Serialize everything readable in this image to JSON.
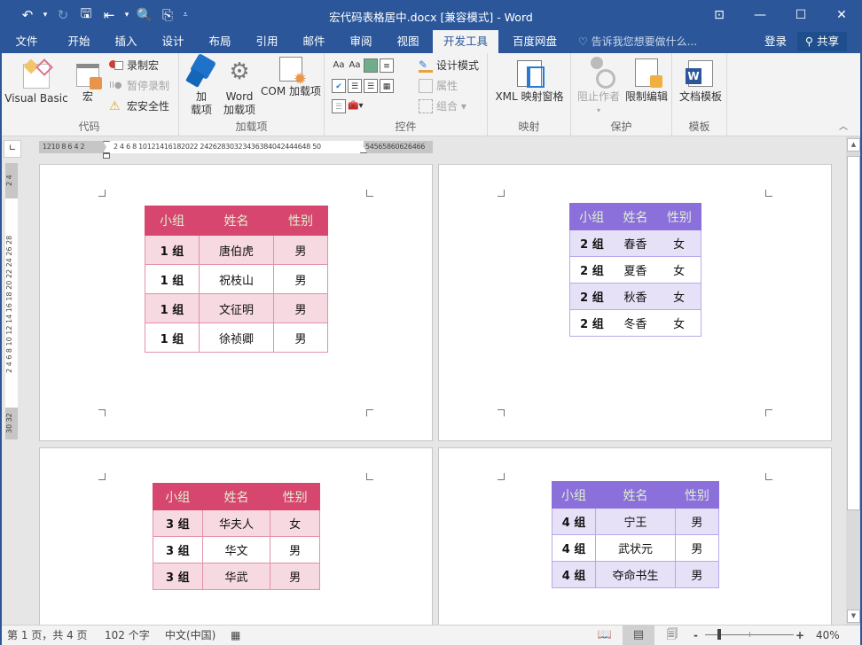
{
  "window": {
    "title": "宏代码表格居中.docx [兼容模式] - Word",
    "qat": [
      {
        "name": "undo-icon",
        "glyph": "↶"
      },
      {
        "name": "undo-dropdown-icon",
        "glyph": "▾"
      },
      {
        "name": "redo-icon",
        "glyph": "↻"
      },
      {
        "name": "save-icon",
        "glyph": "🖫"
      },
      {
        "name": "touch-mode-icon",
        "glyph": "⇤"
      },
      {
        "name": "touch-dropdown-icon",
        "glyph": "▾"
      },
      {
        "name": "print-preview-icon",
        "glyph": "🔍"
      },
      {
        "name": "new-comment-icon",
        "glyph": "⎘"
      },
      {
        "name": "customize-qat-icon",
        "glyph": "⩡"
      }
    ],
    "controls": {
      "ribbon_display": "⊡",
      "minimize": "—",
      "maximize": "☐",
      "close": "✕"
    }
  },
  "tabs": [
    {
      "label": "文件"
    },
    {
      "label": "开始"
    },
    {
      "label": "插入"
    },
    {
      "label": "设计"
    },
    {
      "label": "布局"
    },
    {
      "label": "引用"
    },
    {
      "label": "邮件"
    },
    {
      "label": "审阅"
    },
    {
      "label": "视图"
    },
    {
      "label": "开发工具",
      "active": true
    },
    {
      "label": "百度网盘"
    }
  ],
  "tellme": {
    "icon": "lightbulb-icon",
    "glyph": "♡",
    "placeholder": "告诉我您想要做什么..."
  },
  "account": {
    "login": "登录",
    "share": "共享",
    "share_glyph": "⚲"
  },
  "ribbon": {
    "groups": {
      "code": {
        "label": "代码",
        "visual_basic": "Visual Basic",
        "macros": "宏",
        "record_macro": "录制宏",
        "pause_recording": "暂停录制",
        "macro_security": "宏安全性"
      },
      "addins": {
        "label": "加载项",
        "addins_line1": "加",
        "addins_line2": "载项",
        "word_addins_line1": "Word",
        "word_addins_line2": "加载项",
        "com_addins": "COM 加载项"
      },
      "controls": {
        "label": "控件",
        "design_mode": "设计模式",
        "properties": "属性",
        "group": "组合 ▾"
      },
      "mapping": {
        "label": "映射",
        "xml_pane": "XML 映射窗格"
      },
      "protect": {
        "label": "保护",
        "block_authors": "阻止作者",
        "restrict_editing": "限制编辑"
      },
      "templates": {
        "label": "模板",
        "document_template": "文档模板"
      }
    }
  },
  "ruler": {
    "corner_glyph": "∟",
    "h_left": "1210 8  6  4  2",
    "h_mid": "2  4  6  8 10121416182022 24262830323436384042444648 50",
    "h_right": "54565860626466",
    "v_top": "2  4",
    "v_mid": "2  4  6  8  10  12  14  16  18  20  22  24  26  28",
    "v_bottom": "30  32"
  },
  "tables": [
    {
      "headers": [
        "小组",
        "姓名",
        "性别"
      ],
      "rows": [
        [
          "1 组",
          "唐伯虎",
          "男"
        ],
        [
          "1 组",
          "祝枝山",
          "男"
        ],
        [
          "1 组",
          "文征明",
          "男"
        ],
        [
          "1 组",
          "徐祯卿",
          "男"
        ]
      ]
    },
    {
      "headers": [
        "小组",
        "姓名",
        "性别"
      ],
      "rows": [
        [
          "2 组",
          "春香",
          "女"
        ],
        [
          "2 组",
          "夏香",
          "女"
        ],
        [
          "2 组",
          "秋香",
          "女"
        ],
        [
          "2 组",
          "冬香",
          "女"
        ]
      ]
    },
    {
      "headers": [
        "小组",
        "姓名",
        "性别"
      ],
      "rows": [
        [
          "3 组",
          "华夫人",
          "女"
        ],
        [
          "3 组",
          "华文",
          "男"
        ],
        [
          "3 组",
          "华武",
          "男"
        ]
      ]
    },
    {
      "headers": [
        "小组",
        "姓名",
        "性别"
      ],
      "rows": [
        [
          "4 组",
          "宁王",
          "男"
        ],
        [
          "4 组",
          "武状元",
          "男"
        ],
        [
          "4 组",
          "夺命书生",
          "男"
        ]
      ]
    }
  ],
  "colors": {
    "brand": "#2b579a",
    "pink_header": "#d6466f",
    "pink_alt": "#f7d9e1",
    "purple_header": "#8b6fdb",
    "purple_alt": "#e7e1f8"
  },
  "status": {
    "page": "第 1 页，共 4 页",
    "words": "102 个字",
    "language": "中文(中国)",
    "macro_glyph": "▦",
    "view_read": "📖",
    "view_print": "▤",
    "view_web": "🗐",
    "zoom_minus": "-",
    "zoom_plus": "+",
    "zoom_level": "40%"
  },
  "scroll": {
    "up": "▲",
    "down": "▼"
  }
}
